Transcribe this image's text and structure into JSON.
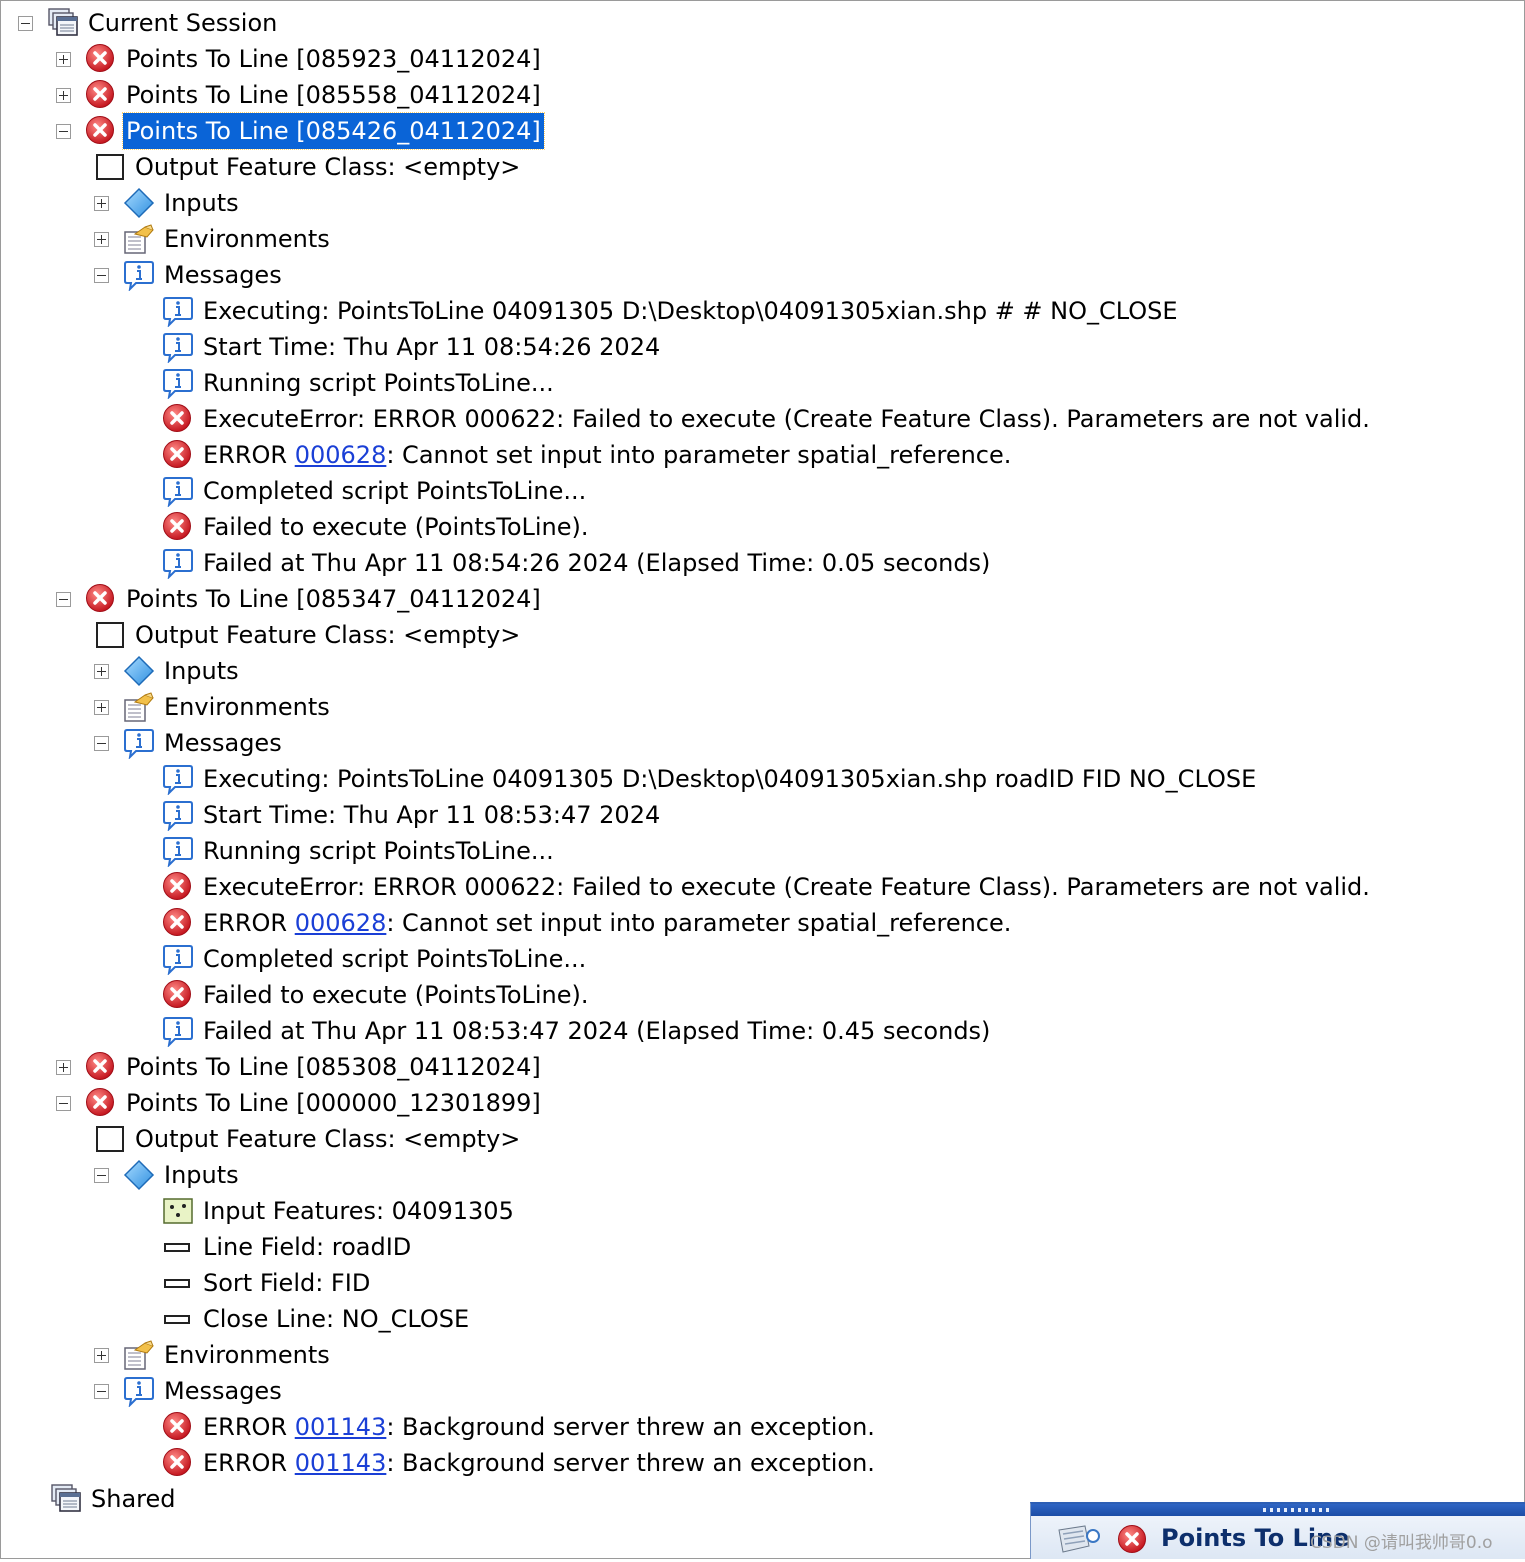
{
  "tree": {
    "session": "Current Session",
    "tasks": [
      {
        "title": "Points To Line [085923_04112024]",
        "expanded": false
      },
      {
        "title": "Points To Line [085558_04112024]",
        "expanded": false
      },
      {
        "title": "Points To Line [085426_04112024]",
        "expanded": true,
        "selected": true,
        "output": "Output Feature Class: <empty>",
        "inputs_label": "Inputs",
        "environments_label": "Environments",
        "messages_label": "Messages",
        "messages": [
          {
            "type": "info",
            "text": "Executing: PointsToLine 04091305 D:\\Desktop\\04091305xian.shp # # NO_CLOSE"
          },
          {
            "type": "info",
            "text": "Start Time: Thu Apr 11 08:54:26 2024"
          },
          {
            "type": "info",
            "text": "Running script PointsToLine..."
          },
          {
            "type": "error",
            "text": "ExecuteError: ERROR 000622: Failed to execute (Create Feature Class). Parameters are not valid."
          },
          {
            "type": "error",
            "prefix": "ERROR ",
            "code": "000628",
            "text": ": Cannot set input into parameter spatial_reference."
          },
          {
            "type": "info",
            "text": "Completed script PointsToLine..."
          },
          {
            "type": "error",
            "text": "Failed to execute (PointsToLine)."
          },
          {
            "type": "info",
            "text": "Failed at Thu Apr 11 08:54:26 2024 (Elapsed Time: 0.05 seconds)"
          }
        ]
      },
      {
        "title": "Points To Line [085347_04112024]",
        "expanded": true,
        "output": "Output Feature Class: <empty>",
        "inputs_label": "Inputs",
        "environments_label": "Environments",
        "messages_label": "Messages",
        "messages": [
          {
            "type": "info",
            "text": "Executing: PointsToLine 04091305 D:\\Desktop\\04091305xian.shp roadID FID NO_CLOSE"
          },
          {
            "type": "info",
            "text": "Start Time: Thu Apr 11 08:53:47 2024"
          },
          {
            "type": "info",
            "text": "Running script PointsToLine..."
          },
          {
            "type": "error",
            "text": "ExecuteError: ERROR 000622: Failed to execute (Create Feature Class). Parameters are not valid."
          },
          {
            "type": "error",
            "prefix": "ERROR ",
            "code": "000628",
            "text": ": Cannot set input into parameter spatial_reference."
          },
          {
            "type": "info",
            "text": "Completed script PointsToLine..."
          },
          {
            "type": "error",
            "text": "Failed to execute (PointsToLine)."
          },
          {
            "type": "info",
            "text": "Failed at Thu Apr 11 08:53:47 2024 (Elapsed Time: 0.45 seconds)"
          }
        ]
      },
      {
        "title": "Points To Line [085308_04112024]",
        "expanded": false
      },
      {
        "title": "Points To Line [000000_12301899]",
        "expanded": true,
        "output": "Output Feature Class: <empty>",
        "inputs_label": "Inputs",
        "inputs_expanded": true,
        "inputs": [
          {
            "kind": "features",
            "text": "Input Features: 04091305"
          },
          {
            "kind": "field",
            "text": "Line Field: roadID"
          },
          {
            "kind": "field",
            "text": "Sort Field: FID"
          },
          {
            "kind": "field",
            "text": "Close Line: NO_CLOSE"
          }
        ],
        "environments_label": "Environments",
        "messages_label": "Messages",
        "messages": [
          {
            "type": "error",
            "prefix": "ERROR ",
            "code": "001143",
            "text": ": Background server threw an exception."
          },
          {
            "type": "error",
            "prefix": "ERROR ",
            "code": "001143",
            "text": ": Background server threw an exception."
          }
        ]
      }
    ],
    "shared": "Shared"
  },
  "popup": {
    "title": "Points To Line"
  },
  "watermark": "CSDN @请叫我帅哥0.o",
  "colors": {
    "selection": "#0a64d7",
    "error": "#d9232e",
    "info": "#2b6fd0",
    "link": "#1a3fd6"
  }
}
